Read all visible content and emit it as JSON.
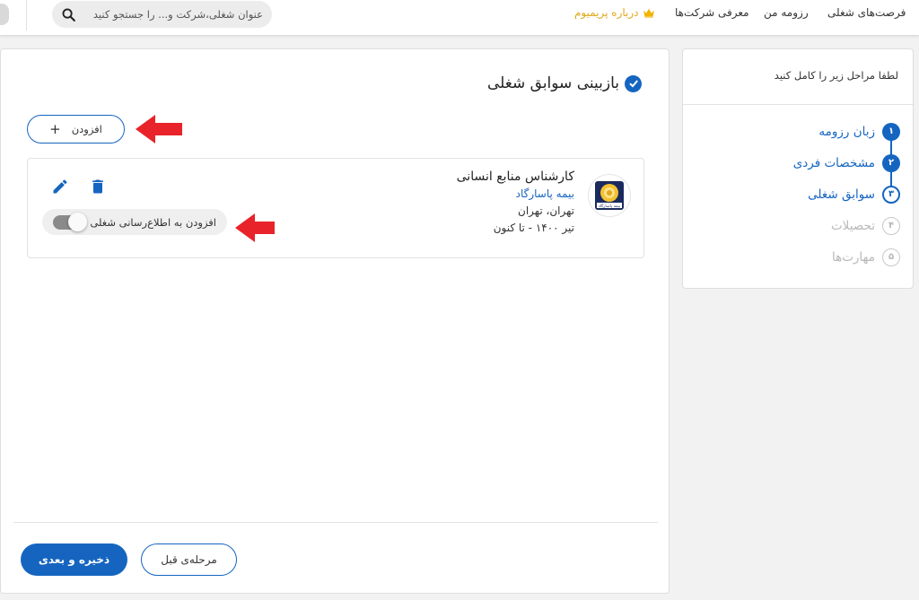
{
  "topbar": {
    "nav": [
      "فرصت‌های شغلی",
      "رزومه من",
      "معرفی شرکت‌ها"
    ],
    "premium_label": "درباره پریمیوم",
    "search_placeholder": "عنوان شغلی،شرکت و... را جستجو کنید"
  },
  "sidebar": {
    "heading": "لطفا مراحل زیر را کامل کنید",
    "steps": [
      {
        "number": "۱",
        "label": "زبان رزومه",
        "state": "done"
      },
      {
        "number": "۲",
        "label": "مشخصات فردی",
        "state": "done"
      },
      {
        "number": "۳",
        "label": "سوابق شغلی",
        "state": "current"
      },
      {
        "number": "۴",
        "label": "تحصیلات",
        "state": "todo"
      },
      {
        "number": "۵",
        "label": "مهارت‌ها",
        "state": "todo"
      }
    ]
  },
  "main": {
    "title": "بازبینی سوابق شغلی",
    "add_label": "افزودن",
    "job": {
      "title": "کارشناس منابع انسانی",
      "company": "بیمه پاسارگاد",
      "location": "تهران، تهران",
      "date": "تیر ۱۴۰۰ - تا کنون",
      "logo_text": "بیمه پاسارگاد",
      "notify_label": "افزودن به اطلاع‌رسانی شغلی",
      "notify_on": false
    },
    "buttons": {
      "next": "ذخیره و بعدی",
      "prev": "مرحله‌ی قبل"
    }
  },
  "colors": {
    "primary": "#1565c0",
    "premium": "#e0a81e",
    "arrow": "#e8232a"
  }
}
